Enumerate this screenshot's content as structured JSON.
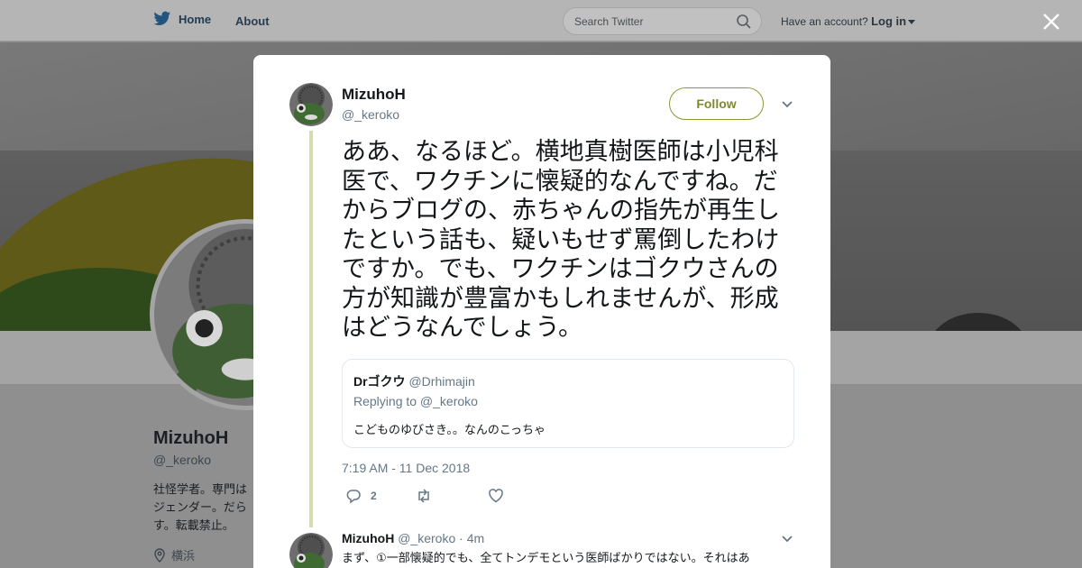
{
  "nav": {
    "home_label": "Home",
    "about_label": "About",
    "search_placeholder": "Search Twitter",
    "account_prompt": "Have an account?",
    "login_label": "Log in"
  },
  "profile": {
    "name": "MizuhoH",
    "handle": "@_keroko",
    "bio": "社怪学者。専門は\nジェンダー。だら\nす。転載禁止。",
    "location": "横浜"
  },
  "tweet": {
    "author_name": "MizuhoH",
    "author_handle": "@_keroko",
    "follow_label": "Follow",
    "text": "ああ、なるほど。横地真樹医師は小児科医で、ワクチンに懐疑的なんですね。だからブログの、赤ちゃんの指先が再生したという話も、疑いもせず罵倒したわけですか。でも、ワクチンはゴクウさんの方が知識が豊富かもしれませんが、形成はどうなんでしょう。",
    "timestamp": "7:19 AM - 11 Dec 2018",
    "reply_count": "2",
    "quoted": {
      "author_name": "Drゴクウ",
      "author_handle": "@Drhimajin",
      "replying_to": "Replying to @_keroko",
      "text": "こどものゆびさき。。なんのこっちゃ"
    }
  },
  "reply": {
    "author_name": "MizuhoH",
    "author_handle": "@_keroko",
    "age": "· 4m",
    "text": "まず、①一部懐疑的でも、全てトンデモという医師ばかりではない。それはあ"
  },
  "colors": {
    "accent": "#7d8a2c",
    "thread_line": "#d6dbb0",
    "muted": "#657786"
  },
  "icons": [
    "twitter-bird-icon",
    "search-icon",
    "close-icon",
    "chevron-down-icon",
    "reply-icon",
    "retweet-icon",
    "like-icon",
    "location-pin-icon"
  ]
}
